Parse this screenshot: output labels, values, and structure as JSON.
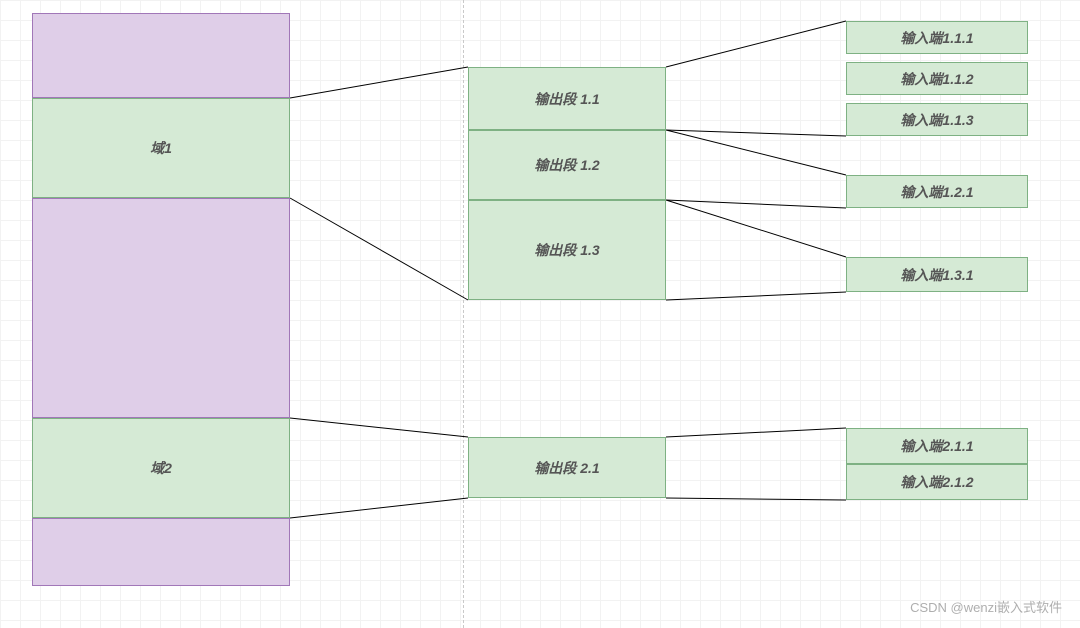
{
  "colors": {
    "purple_bg": "#dfcee8",
    "purple_border": "#a177b8",
    "green_bg": "#d5ead5",
    "green_border": "#7eb183"
  },
  "watermark": "CSDN @wenzi嵌入式软件",
  "left": {
    "domain1": {
      "label": "域1"
    },
    "domain2": {
      "label": "域2"
    }
  },
  "middle": {
    "out11": {
      "label": "输出段 1.1"
    },
    "out12": {
      "label": "输出段 1.2"
    },
    "out13": {
      "label": "输出段 1.3"
    },
    "out21": {
      "label": "输出段 2.1"
    }
  },
  "right": {
    "in111": {
      "label": "输入端1.1.1"
    },
    "in112": {
      "label": "输入端1.1.2"
    },
    "in113": {
      "label": "输入端1.1.3"
    },
    "in121": {
      "label": "输入端1.2.1"
    },
    "in131": {
      "label": "输入端1.3.1"
    },
    "in211": {
      "label": "输入端2.1.1"
    },
    "in212": {
      "label": "输入端2.1.2"
    }
  }
}
